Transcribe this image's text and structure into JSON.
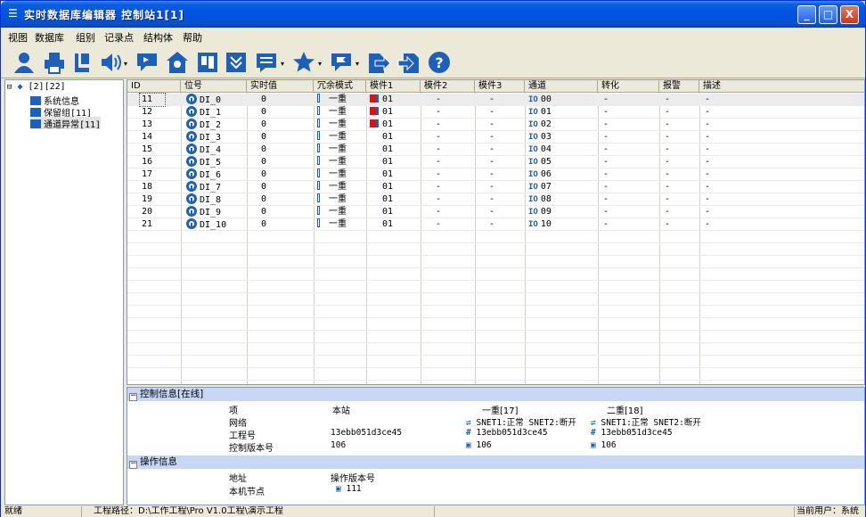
{
  "window": {
    "title": "实时数据库编辑器 控制站1[1]",
    "min_label": "_",
    "max_label": "□",
    "close_label": "X"
  },
  "menu": [
    "视图",
    "数据库",
    "组别",
    "记录点",
    "结构体",
    "帮助"
  ],
  "toolbar": [
    "user-icon",
    "print-icon",
    "book-icon",
    "speaker-icon",
    "chat-icon",
    "home-icon",
    "panel-icon",
    "sort-icon",
    "list-icon",
    "star-icon",
    "flag-icon",
    "export-icon",
    "import-icon",
    "help-icon"
  ],
  "tree": {
    "root": "[2][22]",
    "items": [
      "系统信息",
      "保留组[11]",
      "通道异常[11]"
    ]
  },
  "grid": {
    "columns": [
      "ID",
      "位号",
      "实时值",
      "冗余模式",
      "模件1",
      "模件2",
      "模件3",
      "通道",
      "转化",
      "报警",
      "描述"
    ],
    "rows": [
      {
        "id": "11",
        "tag": "DI_0",
        "value": "0",
        "mode": "一重",
        "m1": "01",
        "m2": "-",
        "m3": "-",
        "ch": "00",
        "conv": "-",
        "alarm": "-",
        "desc": "-",
        "flag": true
      },
      {
        "id": "12",
        "tag": "DI_1",
        "value": "0",
        "mode": "一重",
        "m1": "01",
        "m2": "-",
        "m3": "-",
        "ch": "01",
        "conv": "-",
        "alarm": "-",
        "desc": "-",
        "flag": true
      },
      {
        "id": "13",
        "tag": "DI_2",
        "value": "0",
        "mode": "一重",
        "m1": "01",
        "m2": "-",
        "m3": "-",
        "ch": "02",
        "conv": "-",
        "alarm": "-",
        "desc": "-",
        "flag": true
      },
      {
        "id": "14",
        "tag": "DI_3",
        "value": "0",
        "mode": "一重",
        "m1": "01",
        "m2": "-",
        "m3": "-",
        "ch": "03",
        "conv": "-",
        "alarm": "-",
        "desc": "-",
        "flag": false
      },
      {
        "id": "15",
        "tag": "DI_4",
        "value": "0",
        "mode": "一重",
        "m1": "01",
        "m2": "-",
        "m3": "-",
        "ch": "04",
        "conv": "-",
        "alarm": "-",
        "desc": "-",
        "flag": false
      },
      {
        "id": "16",
        "tag": "DI_5",
        "value": "0",
        "mode": "一重",
        "m1": "01",
        "m2": "-",
        "m3": "-",
        "ch": "05",
        "conv": "-",
        "alarm": "-",
        "desc": "-",
        "flag": false
      },
      {
        "id": "17",
        "tag": "DI_6",
        "value": "0",
        "mode": "一重",
        "m1": "01",
        "m2": "-",
        "m3": "-",
        "ch": "06",
        "conv": "-",
        "alarm": "-",
        "desc": "-",
        "flag": false
      },
      {
        "id": "18",
        "tag": "DI_7",
        "value": "0",
        "mode": "一重",
        "m1": "01",
        "m2": "-",
        "m3": "-",
        "ch": "07",
        "conv": "-",
        "alarm": "-",
        "desc": "-",
        "flag": false
      },
      {
        "id": "19",
        "tag": "DI_8",
        "value": "0",
        "mode": "一重",
        "m1": "01",
        "m2": "-",
        "m3": "-",
        "ch": "08",
        "conv": "-",
        "alarm": "-",
        "desc": "-",
        "flag": false
      },
      {
        "id": "20",
        "tag": "DI_9",
        "value": "0",
        "mode": "一重",
        "m1": "01",
        "m2": "-",
        "m3": "-",
        "ch": "09",
        "conv": "-",
        "alarm": "-",
        "desc": "-",
        "flag": false
      },
      {
        "id": "21",
        "tag": "DI_10",
        "value": "0",
        "mode": "一重",
        "m1": "01",
        "m2": "-",
        "m3": "-",
        "ch": "10",
        "conv": "-",
        "alarm": "-",
        "desc": "-",
        "flag": false
      }
    ],
    "io_label": "IO"
  },
  "control_info": {
    "header": "控制信息[在线]",
    "col_item": "项",
    "col_local": "本站",
    "col_single": "一重[17]",
    "col_double": "二重[18]",
    "rows": [
      {
        "label": "网络",
        "local": "",
        "single": "SNET1:正常 SNET2:断开",
        "double": "SNET1:正常 SNET2:断开"
      },
      {
        "label": "工程号",
        "local": "13ebb051d3ce45",
        "single": "13ebb051d3ce45",
        "double": "13ebb051d3ce45"
      },
      {
        "label": "控制版本号",
        "local": "106",
        "single": "106",
        "double": "106"
      }
    ]
  },
  "op_info": {
    "header": "操作信息",
    "col_addr": "地址",
    "col_ver": "操作版本号",
    "rows": [
      {
        "label": "本机节点",
        "ver": "111"
      }
    ]
  },
  "status": {
    "ready": "就绪",
    "path": "工程路径：D:\\工作工程\\Pro V1.0工程\\演示工程",
    "user": "当前用户：系统"
  },
  "colors": {
    "title": "#0054e3",
    "section": "#c8d7f5",
    "accent_blue": "#1e5fb8",
    "flag_red": "#e01010"
  }
}
